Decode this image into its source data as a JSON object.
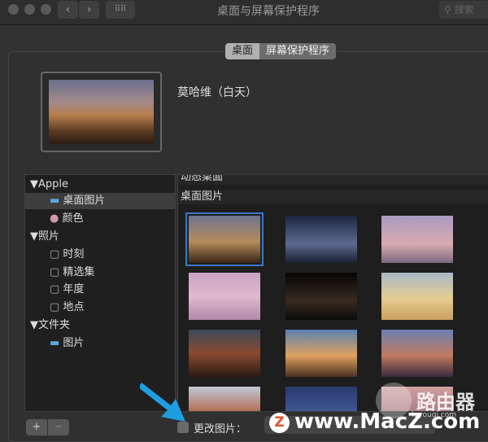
{
  "window": {
    "title": "桌面与屏幕保护程序",
    "search_placeholder": "搜索",
    "back": "‹",
    "forward": "›",
    "grid_icon": "grid-icon"
  },
  "tabs": [
    {
      "label": "桌面",
      "selected": true
    },
    {
      "label": "屏幕保护程序",
      "selected": false
    }
  ],
  "current": {
    "name": "莫哈维（白天）"
  },
  "sidebar": {
    "groups": [
      {
        "label": "Apple",
        "items": [
          {
            "label": "桌面图片",
            "icon": "folder-icon",
            "selected": true
          },
          {
            "label": "颜色",
            "icon": "color-wheel-icon"
          }
        ]
      },
      {
        "label": "照片",
        "items": [
          {
            "label": "时刻",
            "icon": "photo-album-icon"
          },
          {
            "label": "精选集",
            "icon": "photo-album-icon"
          },
          {
            "label": "年度",
            "icon": "photo-album-icon"
          },
          {
            "label": "地点",
            "icon": "photo-album-icon"
          }
        ]
      },
      {
        "label": "文件夹",
        "items": [
          {
            "label": "图片",
            "icon": "folder-icon"
          }
        ]
      }
    ]
  },
  "grid": {
    "section_dynamic": "动态桌面",
    "section_pictures": "桌面图片"
  },
  "bottom": {
    "add": "+",
    "remove": "−",
    "change_picture": "更改图片：",
    "change_checked": false
  },
  "watermarks": {
    "router": "路由器",
    "router_sub": "luyouqi.com",
    "macz": "www.MacZ.com",
    "macz_logo": "Z"
  },
  "colors": {
    "accent": "#3b78c6",
    "arrow": "#1e9ee0"
  }
}
